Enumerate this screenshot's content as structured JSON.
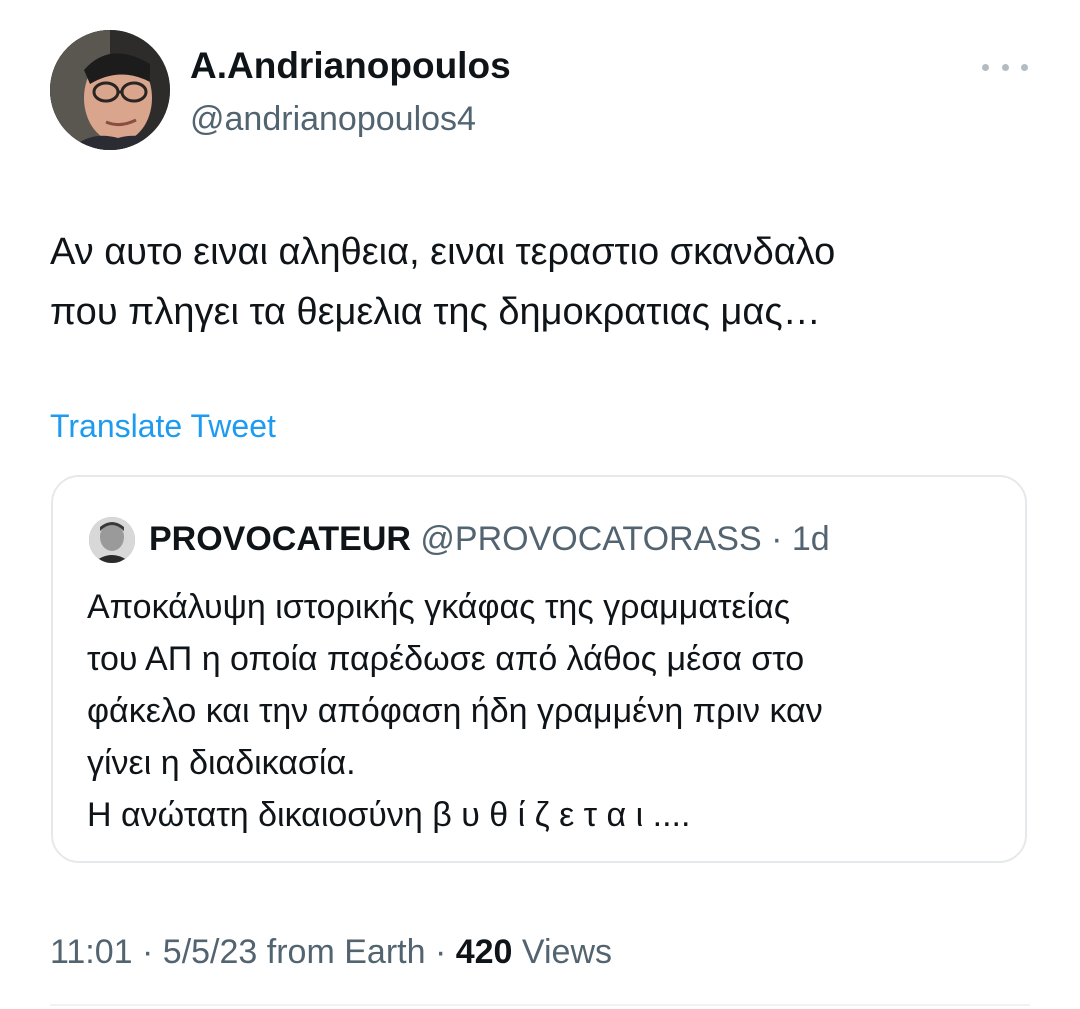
{
  "author": {
    "display_name": "A.Andrianopoulos",
    "handle": "@andrianopoulos4"
  },
  "more_icon": "more-horizontal-icon",
  "tweet": {
    "lines": [
      "Αν αυτο ειναι αληθεια, ειναι τεραστιο σκανδαλο",
      "που πληγει τα θεμελια της δημοκρατιας μας…"
    ],
    "translate_label": "Translate Tweet"
  },
  "quote": {
    "name": "PROVOCATEUR",
    "handle": "@PROVOCATORASS",
    "separator": "·",
    "time": "1d",
    "lines": [
      "Αποκάλυψη ιστορικής γκάφας της γραμματείας",
      "του ΑΠ η οποία παρέδωσε από λάθος μέσα στο",
      "φάκελο και την απόφαση ήδη γραμμένη πριν καν",
      "γίνει η διαδικασία.",
      "Η ανώτατη δικαιοσύνη  β υ θ ί ζ ε τ α ι ...."
    ]
  },
  "meta": {
    "time": "11:01",
    "sep1": "·",
    "date": "5/5/23",
    "source": "from Earth",
    "sep2": "·",
    "views_count": "420",
    "views_label": "Views"
  }
}
